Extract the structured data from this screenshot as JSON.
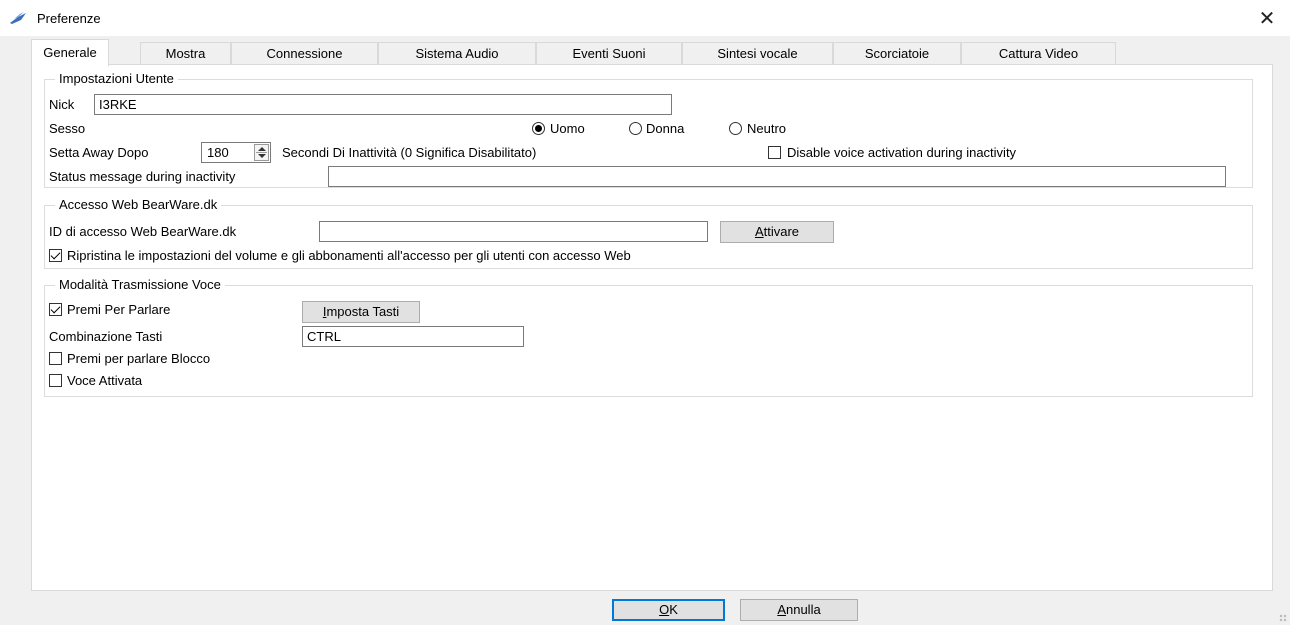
{
  "window": {
    "title": "Preferenze"
  },
  "tabs": [
    {
      "label": "Generale",
      "active": true
    },
    {
      "label": "Mostra"
    },
    {
      "label": "Connessione"
    },
    {
      "label": "Sistema Audio"
    },
    {
      "label": "Eventi Suoni"
    },
    {
      "label": "Sintesi vocale"
    },
    {
      "label": "Scorciatoie"
    },
    {
      "label": "Cattura Video"
    }
  ],
  "user_settings": {
    "title": "Impostazioni Utente",
    "nick_label": "Nick",
    "nick_value": "I3RKE",
    "gender_label": "Sesso",
    "gender_options": [
      "Uomo",
      "Donna",
      "Neutro"
    ],
    "gender_selected": "Uomo",
    "away_label": "Setta Away Dopo",
    "away_value": "180",
    "away_suffix": "Secondi Di Inattività (0 Significa Disabilitato)",
    "disable_voice_label": "Disable voice activation during inactivity",
    "status_label": "Status message during inactivity",
    "status_value": ""
  },
  "web_login": {
    "title": "Accesso Web BearWare.dk",
    "id_label": "ID di accesso Web BearWare.dk",
    "id_value": "",
    "activate_prefix": "",
    "activate_accel": "A",
    "activate_rest": "ttivare",
    "restore_label": "Ripristina le impostazioni del volume e gli abbonamenti all'accesso per gli utenti con accesso Web",
    "restore_checked": true
  },
  "voice_tx": {
    "title": "Modalità Trasmissione Voce",
    "ptt_label": "Premi Per Parlare",
    "ptt_checked": true,
    "set_keys_accel": "I",
    "set_keys_rest": "mposta Tasti",
    "key_combo_label": "Combinazione Tasti",
    "key_combo_value": "CTRL",
    "ptt_lock_label": "Premi per parlare Blocco",
    "voice_activated_label": "Voce Attivata"
  },
  "footer": {
    "ok_accel": "O",
    "ok_rest": "K",
    "cancel_accel": "A",
    "cancel_rest": "nnulla"
  },
  "colors": {
    "accent": "#0078d7",
    "panel": "#ffffff",
    "chrome": "#f0f0f0"
  }
}
